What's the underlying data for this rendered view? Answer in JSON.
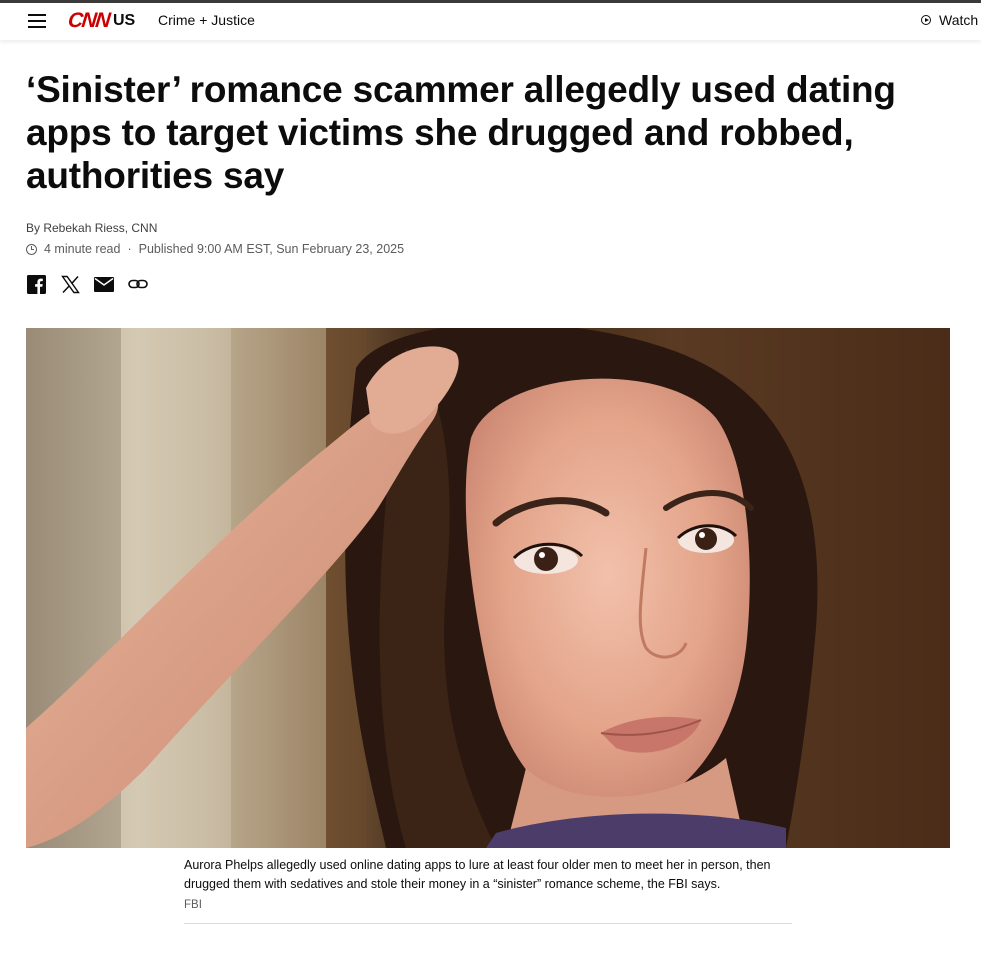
{
  "header": {
    "menu_icon": "hamburger-menu-icon",
    "logo_text": "CNN",
    "logo_section": "US",
    "section": "Crime + Justice",
    "watch_label": "Watch",
    "watch_icon": "play-circle-icon",
    "brand_color": "#cc0000"
  },
  "article": {
    "headline": "‘Sinister’ romance scammer allegedly used dating apps to target victims she drugged and robbed, authorities say",
    "byline": "By Rebekah Riess, CNN",
    "read_time": "4 minute read",
    "separator": "·",
    "published": "Published 9:00 AM EST, Sun February 23, 2025",
    "share_icons": [
      "facebook-icon",
      "x-icon",
      "email-icon",
      "link-icon"
    ]
  },
  "media": {
    "caption": "Aurora Phelps allegedly used online dating apps to lure at least four older men to meet her in person, then drugged them with sedatives and stole their money in a “sinister” romance scheme, the FBI says.",
    "credit": "FBI"
  }
}
